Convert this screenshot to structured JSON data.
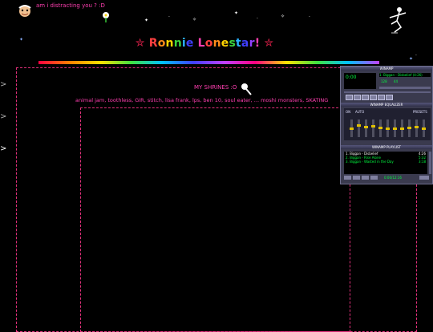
{
  "header": {
    "distract_text": "am i distracting you ? :D",
    "title_left_star": "✮",
    "title_letters": [
      "R",
      "o",
      "n",
      "n",
      "i",
      "e",
      " ",
      "L",
      "o",
      "n",
      "e",
      "s",
      "t",
      "a",
      "r",
      "!"
    ],
    "title_colors": [
      "#ff4040",
      "#ff8c1a",
      "#ffd400",
      "#3cd23c",
      "#2ab0ff",
      "#3f3fff",
      "#9040ff",
      "#ff3fb0",
      "#ff4040",
      "#ff8c1a",
      "#ffd400",
      "#3cd23c",
      "#2ab0ff",
      "#3f3fff",
      "#9040ff",
      "#ff3fb0"
    ],
    "title_right_star": "✮"
  },
  "shrines": {
    "heading": "MY SHRINES :O",
    "list": "animal jam, toothless, GIR, stitch, lisa frank, lps, ben 10, soul eater, ... moshi monsters, SKATING"
  },
  "nav_arrows": [
    ">",
    ">",
    ">"
  ],
  "winamp": {
    "main_title": "WINAMP",
    "time": "0:00",
    "scroll_text": "1. Biggan - Disbelief (4:26)",
    "kbps": "128",
    "khz": "44",
    "eq_title": "WINAMP EQUALIZER",
    "eq_labels": [
      "ON",
      "AUTO",
      "PRESETS"
    ],
    "eq_levels": [
      0.5,
      0.3,
      0.4,
      0.35,
      0.45,
      0.5,
      0.55,
      0.5,
      0.45,
      0.4,
      0.5
    ],
    "playlist_title": "WINAMP PLAYLIST",
    "playlist": [
      {
        "title": "1. Biggan - Disbelief",
        "time": "4:26"
      },
      {
        "title": "2. Biggan - Rise Alone",
        "time": "5:32"
      },
      {
        "title": "3. Biggan - Wasted in the Day",
        "time": "3:18"
      }
    ],
    "pl_time": "0:00/12:16",
    "pl_buttons": [
      "ADD",
      "REM",
      "SEL",
      "MISC",
      "LIST"
    ]
  },
  "colors": {
    "accent_pink": "#ff3fb0",
    "frame_border": "#e0307a",
    "background": "#000000"
  }
}
